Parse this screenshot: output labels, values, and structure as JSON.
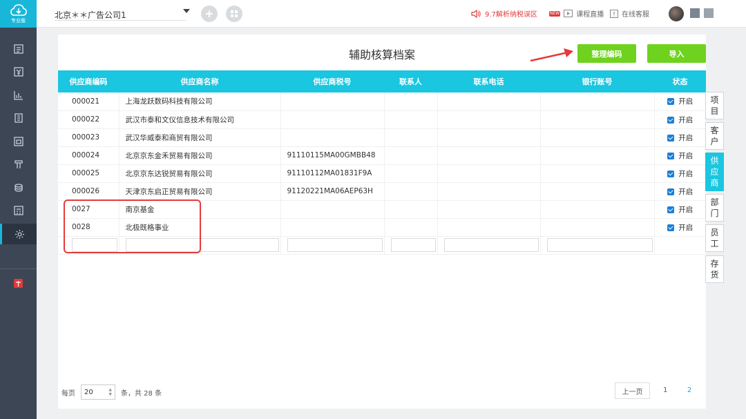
{
  "app": {
    "edition_label": "专业版"
  },
  "topbar": {
    "company": "北京＊＊广告公司1",
    "notice": "9.7解析纳税误区",
    "live_badge": "NEW",
    "live": "课程直播",
    "support": "在线客服"
  },
  "page": {
    "title": "辅助核算档案",
    "btn_organize": "整理编码",
    "btn_import": "导入"
  },
  "table": {
    "headers": [
      "供应商编码",
      "供应商名称",
      "供应商税号",
      "联系人",
      "联系电话",
      "银行账号",
      "状态"
    ],
    "rows": [
      {
        "code": "000021",
        "name": "上海龙跃数码科技有限公司",
        "tax": "",
        "contact": "",
        "phone": "",
        "bank": "",
        "status": "开启"
      },
      {
        "code": "000022",
        "name": "武汉市泰和文仪信息技术有限公司",
        "tax": "",
        "contact": "",
        "phone": "",
        "bank": "",
        "status": "开启"
      },
      {
        "code": "000023",
        "name": "武汉华威泰和商贸有限公司",
        "tax": "",
        "contact": "",
        "phone": "",
        "bank": "",
        "status": "开启"
      },
      {
        "code": "000024",
        "name": "北京京东金禾贸易有限公司",
        "tax": "91110115MA00GMBB48",
        "contact": "",
        "phone": "",
        "bank": "",
        "status": "开启"
      },
      {
        "code": "000025",
        "name": "北京京东达锐贸易有限公司",
        "tax": "91110112MA01831F9A",
        "contact": "",
        "phone": "",
        "bank": "",
        "status": "开启"
      },
      {
        "code": "000026",
        "name": "天津京东启正贸易有限公司",
        "tax": "91120221MA06AEP63H",
        "contact": "",
        "phone": "",
        "bank": "",
        "status": "开启"
      },
      {
        "code": "0027",
        "name": "南京基金",
        "tax": "",
        "contact": "",
        "phone": "",
        "bank": "",
        "status": "开启"
      },
      {
        "code": "0028",
        "name": "北极既格事业",
        "tax": "",
        "contact": "",
        "phone": "",
        "bank": "",
        "status": "开启"
      }
    ]
  },
  "pager": {
    "per_page_label": "每页",
    "per_page_value": "20",
    "total_text": "条，共 28 条",
    "prev": "上一页",
    "pages": [
      "1",
      "2"
    ],
    "current_page": "2"
  },
  "right_tabs": [
    "项目",
    "客户",
    "供应商",
    "部门",
    "员工",
    "存货"
  ],
  "active_right_tab": "供应商",
  "colors": {
    "accent": "#1ac6e0",
    "green": "#6fd21f",
    "alert": "#e43a3a",
    "sidebar": "#3c4655"
  }
}
